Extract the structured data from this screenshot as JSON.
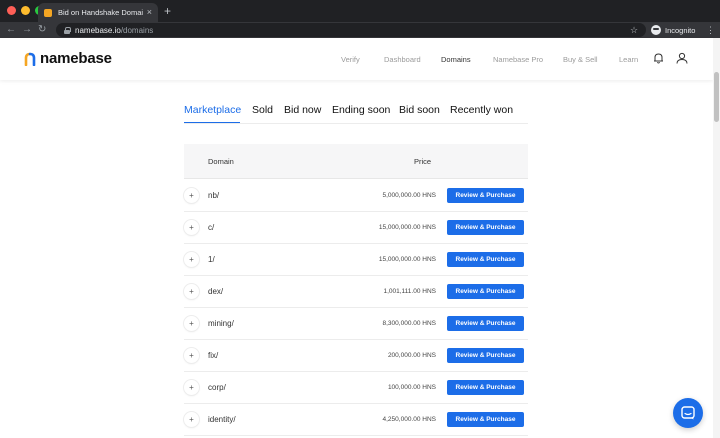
{
  "browser": {
    "tab_title": "Bid on Handshake Domains | N",
    "url_host": "namebase.io",
    "url_path": "/domains",
    "profile_label": "Incognito",
    "new_tab_glyph": "+",
    "close_glyph": "×"
  },
  "header": {
    "logo_text": "namebase",
    "nav": [
      {
        "label": "Verify"
      },
      {
        "label": "Dashboard"
      },
      {
        "label": "Domains"
      },
      {
        "label": "Namebase Pro"
      },
      {
        "label": "Buy & Sell"
      },
      {
        "label": "Learn"
      }
    ],
    "active_nav": "Domains"
  },
  "marketplace": {
    "tabs": [
      {
        "label": "Marketplace"
      },
      {
        "label": "Sold"
      },
      {
        "label": "Bid now"
      },
      {
        "label": "Ending soon"
      },
      {
        "label": "Bid soon"
      },
      {
        "label": "Recently won"
      }
    ],
    "active_tab": "Marketplace",
    "columns": {
      "domain": "Domain",
      "price": "Price"
    },
    "expand_glyph": "+",
    "button_label": "Review & Purchase",
    "rows": [
      {
        "domain": "nb/",
        "price": "5,000,000.00 HNS"
      },
      {
        "domain": "c/",
        "price": "15,000,000.00 HNS"
      },
      {
        "domain": "1/",
        "price": "15,000,000.00 HNS"
      },
      {
        "domain": "dex/",
        "price": "1,001,111.00 HNS"
      },
      {
        "domain": "mining/",
        "price": "8,300,000.00 HNS"
      },
      {
        "domain": "fix/",
        "price": "200,000.00 HNS"
      },
      {
        "domain": "corp/",
        "price": "100,000.00 HNS"
      },
      {
        "domain": "identity/",
        "price": "4,250,000.00 HNS"
      }
    ]
  },
  "colors": {
    "accent": "#1c6de8",
    "logo_orange": "#f5a623",
    "logo_blue": "#1c6de8"
  },
  "icons": [
    "bell-icon",
    "user-icon",
    "chat-icon",
    "lock-icon",
    "star-icon",
    "incognito-icon"
  ]
}
